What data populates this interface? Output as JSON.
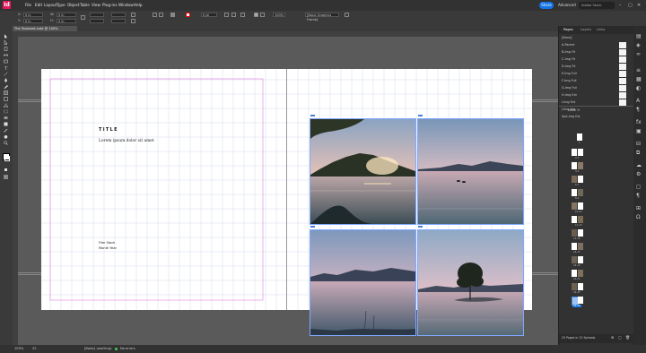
{
  "app": {
    "logo": "Id"
  },
  "menu": [
    "File",
    "Edit",
    "Layout",
    "Type",
    "Object",
    "Table",
    "View",
    "Plug-ins",
    "Window",
    "Help"
  ],
  "topbar": {
    "share": "Share",
    "workspace": "Advanced",
    "search_placeholder": "Adobe Stock"
  },
  "control": {
    "x": "0 in",
    "y": "0 in",
    "w": "0 in",
    "h": "0 in",
    "stroke": "0 pt",
    "zoom": "100%",
    "frame_fitting": "[Basic Graphics Frame]"
  },
  "document_tab": {
    "title": "The Toolshed.indd @ 100%"
  },
  "page_content": {
    "title": "TITLE",
    "subtitle": "Lorem ipsum dolor sit amet",
    "caption_line1": "Film Stock",
    "caption_line2": "Month Year"
  },
  "panel": {
    "tabs": [
      "Pages",
      "Layers",
      "Links"
    ],
    "masters": [
      "[None]",
      "A-Parent",
      "B-Img Fit",
      "C-Img Fit",
      "D-Img Fit",
      "E-Img Full",
      "F-Img Full",
      "G-Img Full",
      "H-Img Ext",
      "I-Img Ext",
      "J-Img Ext",
      "Spd-Img Ext"
    ],
    "section_label": "Letter H",
    "spread_labels": [
      "1",
      "2-3",
      "4-5",
      "6-7",
      "8-9",
      "10-11",
      "12-13",
      "14-15",
      "16-17",
      "18-19",
      "20-21",
      "22-23",
      "24-25"
    ],
    "footer": "25 Pages in 13 Spreads"
  },
  "status": {
    "zoom": "100%",
    "page": "22",
    "style": "[Basic] (working)",
    "preflight": "No errors"
  },
  "colors": {
    "accent": "#1473e6",
    "margin": "#e27ae2",
    "frame": "#4a7fdb",
    "logo": "#e3185b"
  },
  "icons": [
    "selection-icon",
    "direct-selection-icon",
    "page-icon",
    "gap-icon",
    "type-icon",
    "line-icon",
    "pen-icon",
    "pencil-icon",
    "rectangle-frame-icon",
    "rectangle-icon",
    "scissors-icon",
    "free-transform-icon",
    "gradient-icon",
    "note-icon",
    "eyedropper-icon",
    "hand-icon",
    "zoom-icon",
    "fill-stroke-icon",
    "normal-mode-icon"
  ]
}
